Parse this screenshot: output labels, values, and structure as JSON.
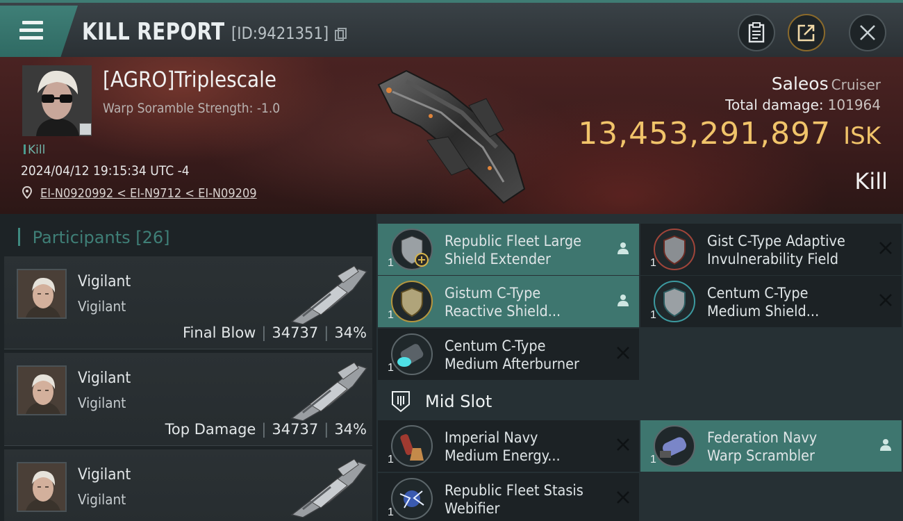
{
  "header": {
    "title": "KILL REPORT",
    "report_id": "[ID:9421351]"
  },
  "victim": {
    "pilot_name": "[AGRO]Triplescale",
    "scramble_strength": "Warp Soramble Strength: -1.0",
    "type_tag": "Kill",
    "datetime": "2024/04/12 19:15:34 UTC -4",
    "location": "EI-N0920992 < EI-N9712 < EI-N09209",
    "ship_name": "Saleos",
    "ship_class": "Cruiser",
    "total_damage_label": "Total damage:",
    "total_damage": "101964",
    "isk_value": "13,453,291,897",
    "isk_unit": "ISK",
    "result": "Kill"
  },
  "participants": {
    "label": "Participants",
    "count": "[26]",
    "rows": [
      {
        "name": "Vigilant",
        "ship": "Vigilant",
        "tag": "Final Blow",
        "damage": "34737",
        "percent": "34%"
      },
      {
        "name": "Vigilant",
        "ship": "Vigilant",
        "tag": "Top Damage",
        "damage": "34737",
        "percent": "34%"
      },
      {
        "name": "Vigilant",
        "ship": "Vigilant",
        "tag": "",
        "damage": "",
        "percent": ""
      }
    ]
  },
  "modules": {
    "items": [
      {
        "qty": "1",
        "line1": "Republic Fleet Large",
        "line2": "Shield Extender",
        "status": "dropped",
        "highlight": true
      },
      {
        "qty": "1",
        "line1": "Gist C-Type Adaptive",
        "line2": "Invulnerability Field",
        "status": "destroyed",
        "highlight": false
      },
      {
        "qty": "1",
        "line1": "Gistum C-Type",
        "line2": "Reactive Shield...",
        "status": "dropped",
        "highlight": true
      },
      {
        "qty": "1",
        "line1": "Centum C-Type",
        "line2": "Medium Shield...",
        "status": "destroyed",
        "highlight": false
      },
      {
        "qty": "1",
        "line1": "Centum C-Type",
        "line2": "Medium Afterburner",
        "status": "destroyed",
        "highlight": false
      }
    ],
    "mid_slot_label": "Mid Slot",
    "mid_items": [
      {
        "qty": "1",
        "line1": "Imperial Navy",
        "line2": "Medium Energy...",
        "status": "destroyed",
        "highlight": false
      },
      {
        "qty": "1",
        "line1": "Federation Navy",
        "line2": "Warp Scrambler",
        "status": "dropped",
        "highlight": true
      },
      {
        "qty": "1",
        "line1": "Republic Fleet Stasis",
        "line2": "Webifier",
        "status": "destroyed",
        "highlight": false
      }
    ]
  },
  "icons": {
    "menu": "hamburger-icon",
    "copy": "copy-icon",
    "clipboard": "clipboard-icon",
    "share": "share-icon",
    "close": "close-icon",
    "location": "location-pin-icon",
    "dropped": "person-icon",
    "destroyed": "x-icon",
    "mid_slot": "mid-slot-icon"
  },
  "colors": {
    "accent": "#3e766f",
    "isk": "#f1c46a",
    "banner": "#3b1c1c"
  }
}
